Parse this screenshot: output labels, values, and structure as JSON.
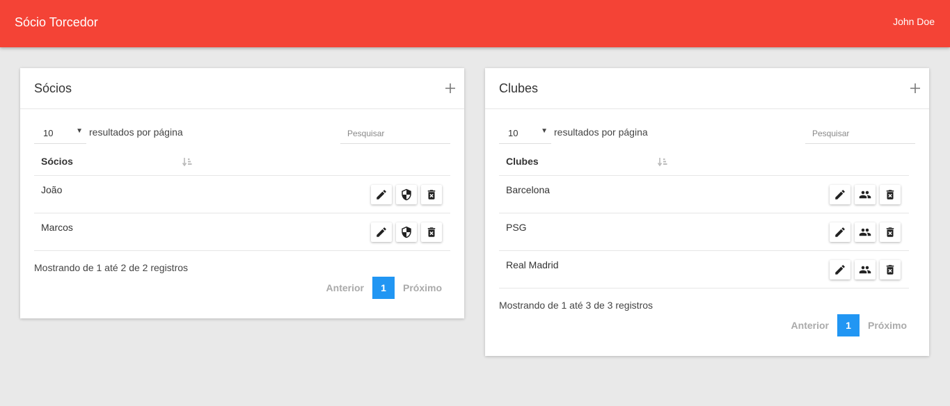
{
  "header": {
    "title": "Sócio Torcedor",
    "user": "John Doe"
  },
  "socios": {
    "title": "Sócios",
    "page_size": "10",
    "results_label": "resultados por página",
    "search_placeholder": "Pesquisar",
    "column_header": "Sócios",
    "rows": [
      "João",
      "Marcos"
    ],
    "info": "Mostrando de 1 até 2 de 2 registros",
    "prev": "Anterior",
    "page": "1",
    "next": "Próximo"
  },
  "clubes": {
    "title": "Clubes",
    "page_size": "10",
    "results_label": "resultados por página",
    "search_placeholder": "Pesquisar",
    "column_header": "Clubes",
    "rows": [
      "Barcelona",
      "PSG",
      "Real Madrid"
    ],
    "info": "Mostrando de 1 até 3 de 3 registros",
    "prev": "Anterior",
    "page": "1",
    "next": "Próximo"
  },
  "colors": {
    "topbar": "#f44336",
    "page_active": "#2196f3",
    "background": "#e9e9e9"
  },
  "icons": {
    "row_actions_socios": [
      "edit-icon",
      "shield-icon",
      "delete-icon"
    ],
    "row_actions_clubes": [
      "edit-icon",
      "people-icon",
      "delete-icon"
    ]
  }
}
